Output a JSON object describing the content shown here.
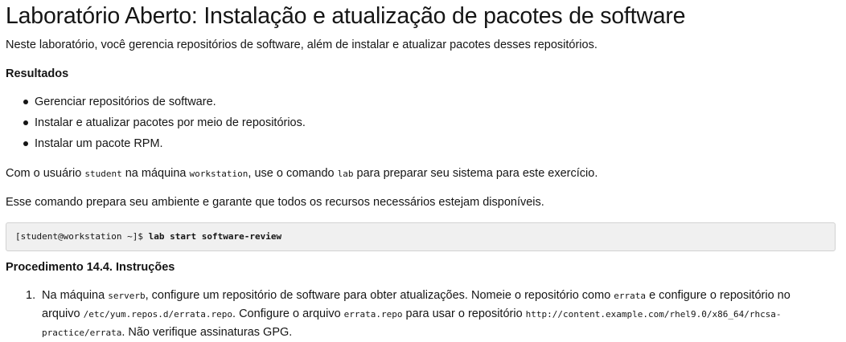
{
  "title": "Laboratório Aberto: Instalação e atualização de pacotes de software",
  "intro": "Neste laboratório, você gerencia repositórios de software, além de instalar e atualizar pacotes desses repositórios.",
  "outcomes": {
    "heading": "Resultados",
    "items": [
      "Gerenciar repositórios de software.",
      "Instalar e atualizar pacotes por meio de repositórios.",
      "Instalar um pacote RPM."
    ]
  },
  "prep": {
    "t1": "Com o usuário ",
    "c1": "student",
    "t2": " na máquina ",
    "c2": "workstation",
    "t3": ", use o comando ",
    "c3": "lab",
    "t4": " para preparar seu sistema para este exercício."
  },
  "prep2": "Esse comando prepara seu ambiente e garante que todos os recursos necessários estejam disponíveis.",
  "command": {
    "prompt": "[student@workstation ~]$ ",
    "text": "lab start software-review"
  },
  "procedure": {
    "heading": "Procedimento 14.4. Instruções",
    "steps": [
      {
        "number": "1.",
        "t1": "Na máquina ",
        "c1": "serverb",
        "t2": ", configure um repositório de software para obter atualizações. Nomeie o repositório como ",
        "c2": "errata",
        "t3": " e configure o repositório no",
        "t4": "arquivo ",
        "c3": "/etc/yum.repos.d/errata.repo",
        "t5": ". Configure o arquivo ",
        "c4": "errata.repo",
        "t6": " para usar o repositório ",
        "c5": "http://content.example.com/rhel9.0/x86_64/rhcsa-",
        "c6": "practice/errata",
        "t7": ". Não verifique assinaturas GPG."
      }
    ]
  }
}
